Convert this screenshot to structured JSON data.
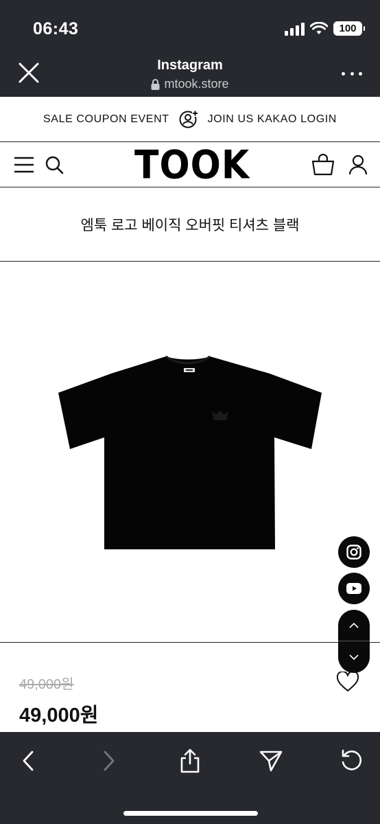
{
  "status_bar": {
    "time": "06:43",
    "battery": "100",
    "icons": [
      "signal-icon",
      "wifi-icon",
      "battery-icon"
    ]
  },
  "browser": {
    "title": "Instagram",
    "url": "mtook.store",
    "close_icon": "close-icon",
    "more_icon": "more-icon"
  },
  "promo": {
    "coupon_label": "SALE COUPON EVENT",
    "join_label": "JOIN US KAKAO LOGIN",
    "icon": "add-user-icon"
  },
  "header": {
    "logo": "TOOK",
    "icons": [
      "menu-icon",
      "search-icon",
      "bag-icon",
      "user-icon"
    ]
  },
  "product": {
    "title": "엠툭 로고 베이직 오버핏 티셔츠 블랙",
    "original_price": "49,000원",
    "sale_price": "49,000원"
  },
  "floating": {
    "icons": [
      "instagram-icon",
      "youtube-icon",
      "chevron-up-icon",
      "chevron-down-icon"
    ]
  },
  "toolbar": {
    "icons": [
      "back-icon",
      "forward-icon",
      "share-icon",
      "send-icon",
      "reload-icon"
    ]
  },
  "colors": {
    "chrome_bg": "#27292e",
    "text": "#111111",
    "muted": "#a9a9a9",
    "shirt": "#050505"
  }
}
